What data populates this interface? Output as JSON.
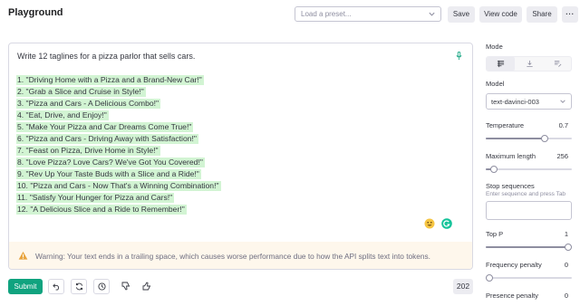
{
  "header": {
    "title": "Playground",
    "preset_placeholder": "Load a preset...",
    "save_label": "Save",
    "view_code_label": "View code",
    "share_label": "Share",
    "more_label": "···"
  },
  "editor": {
    "prompt": "Write 12 taglines for a pizza parlor that sells cars.",
    "completions": [
      "1. \"Driving Home with a Pizza and a Brand-New Car!\"",
      "2. \"Grab a Slice and Cruise in Style!\"",
      "3. \"Pizza and Cars - A Delicious Combo!\"",
      "4. \"Eat, Drive, and Enjoy!\"",
      "5. \"Make Your Pizza and Car Dreams Come True!\"",
      "6. \"Pizza and Cars - Driving Away with Satisfaction!\"",
      "7. \"Feast on Pizza, Drive Home in Style!\"",
      "8. \"Love Pizza? Love Cars? We've Got You Covered!\"",
      "9. \"Rev Up Your Taste Buds with a Slice and a Ride!\"",
      "10. \"Pizza and Cars - Now That's a Winning Combination!\"",
      "11. \"Satisfy Your Hunger for Pizza and Cars!\"",
      "12. \"A Delicious Slice and a Ride to Remember!\""
    ],
    "highlight_color": "#d2f4d3",
    "warning": "Warning: Your text ends in a trailing space, which causes worse performance due to how the API splits text into tokens."
  },
  "toolbar": {
    "submit_label": "Submit",
    "token_count": "202",
    "accent_color": "#10a37f"
  },
  "settings": {
    "mode_label": "Mode",
    "model_label": "Model",
    "model_value": "text-davinci-003",
    "temperature": {
      "label": "Temperature",
      "value": "0.7",
      "fraction": 0.7
    },
    "max_length": {
      "label": "Maximum length",
      "value": "256",
      "fraction": 0.06
    },
    "stop_label": "Stop sequences",
    "stop_hint": "Enter sequence and press Tab",
    "top_p": {
      "label": "Top P",
      "value": "1",
      "fraction": 1.0
    },
    "frequency_penalty": {
      "label": "Frequency penalty",
      "value": "0",
      "fraction": 0.0
    },
    "presence_penalty": {
      "label": "Presence penalty",
      "value": "0"
    }
  }
}
